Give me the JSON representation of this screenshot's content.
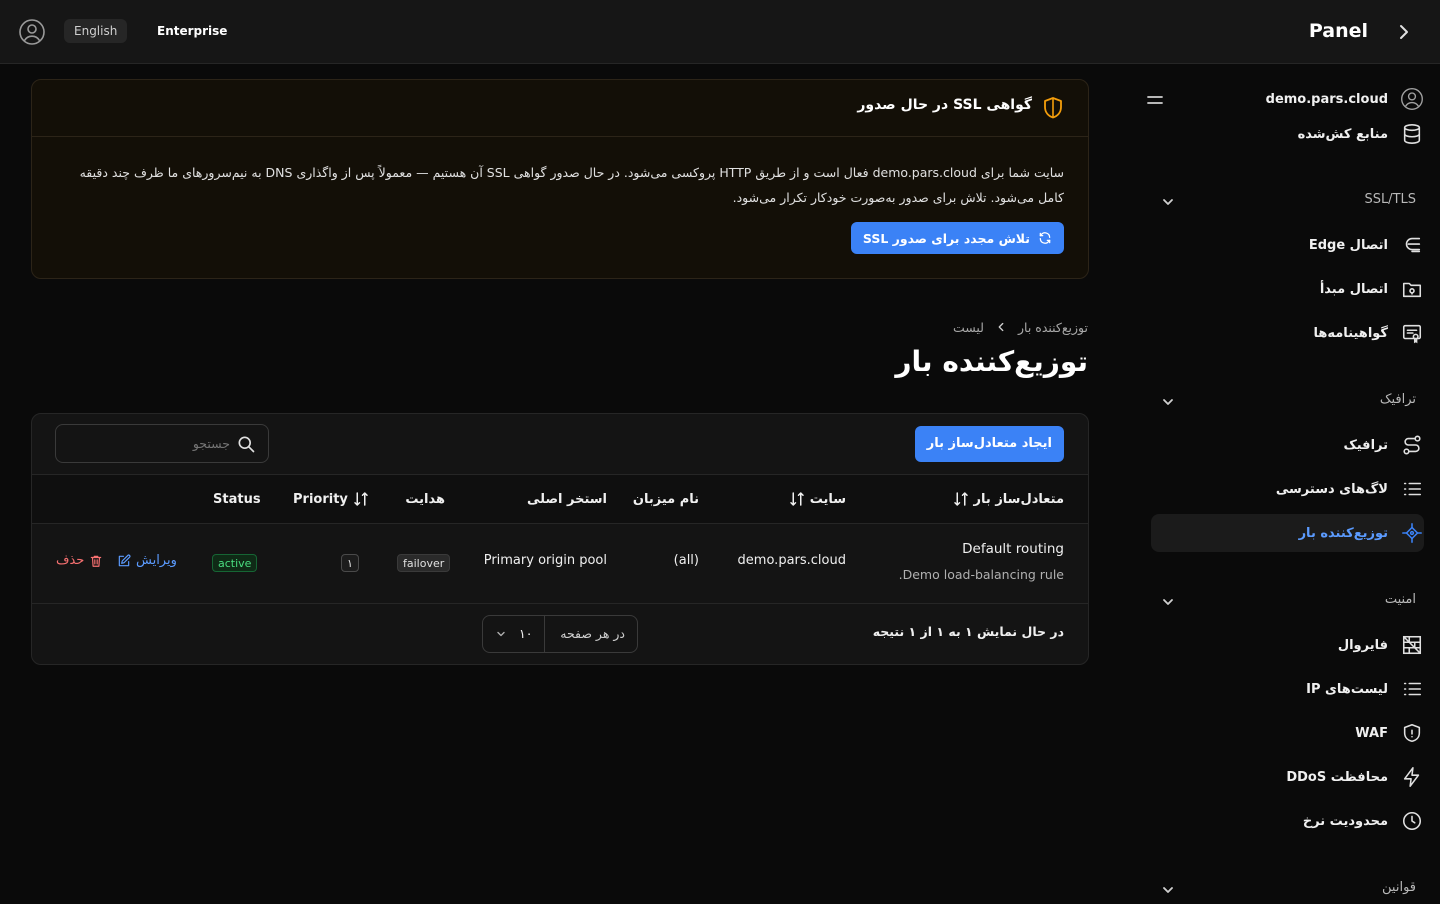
{
  "topbar": {
    "language": "English",
    "plan": "Enterprise",
    "title": "Panel",
    "icons": {
      "user": "user-circle-icon",
      "toggle": "chevron-right-icon"
    }
  },
  "sidebar": {
    "domain": "demo.pars.cloud",
    "resources": "منابع کش‌شده",
    "sections": [
      {
        "title": "SSL/TLS",
        "items": [
          "اتصال Edge",
          "اتصال مبدأ",
          "گواهینامه‌ها"
        ]
      },
      {
        "title": "ترافیک",
        "items": [
          "ترافیک",
          "لاگ‌های دسترسی",
          "توزیع‌کننده بار"
        ]
      },
      {
        "title": "امنیت",
        "items": [
          "فایروال",
          "لیست‌های IP",
          "WAF",
          "محافظت DDoS",
          "محدودیت نرخ"
        ]
      },
      {
        "title": "قوانین"
      }
    ],
    "active_item": "توزیع‌کننده بار",
    "accent_color": "#3b82f6"
  },
  "ssl_notice": {
    "title": "گواهی SSL در حال صدور",
    "line1": "سایت شما برای demo.pars.cloud فعال است و از طریق HTTP پروکسی می‌شود. در حال صدور گواهی SSL آن هستیم — معمولاً پس از واگذاری DNS به نیم‌سرورهای ما ظرف چند دقیقه",
    "line2": "کامل می‌شود. تلاش برای صدور به‌صورت خودکار تکرار می‌شود.",
    "retry_button": "تلاش مجدد برای صدور SSL",
    "accent_color": "#f59e0b"
  },
  "page": {
    "breadcrumb": [
      "توزیع‌کننده بار",
      "لیست"
    ],
    "title": "توزیع‌کننده بار"
  },
  "table": {
    "create_button": "ایجاد متعادل‌ساز بار",
    "search_placeholder": "جستجو",
    "columns": [
      "متعادل‌ساز بار",
      "سایت",
      "نام میزبان",
      "استخر اصلی",
      "هدایت",
      "Priority",
      "Status"
    ],
    "rows": [
      {
        "name": "Default routing",
        "description": "Demo load-balancing rule.",
        "site": "demo.pars.cloud",
        "hostname": "(all)",
        "pool": "Primary origin pool",
        "steering": "failover",
        "priority": "۱",
        "status": "active",
        "edit": "ویرایش",
        "delete": "حذف"
      }
    ],
    "footer": {
      "showing": "در حال نمایش ۱ به ۱ از ۱ نتیجه",
      "per_page_label": "در هر صفحه",
      "per_page_value": "۱۰"
    }
  }
}
